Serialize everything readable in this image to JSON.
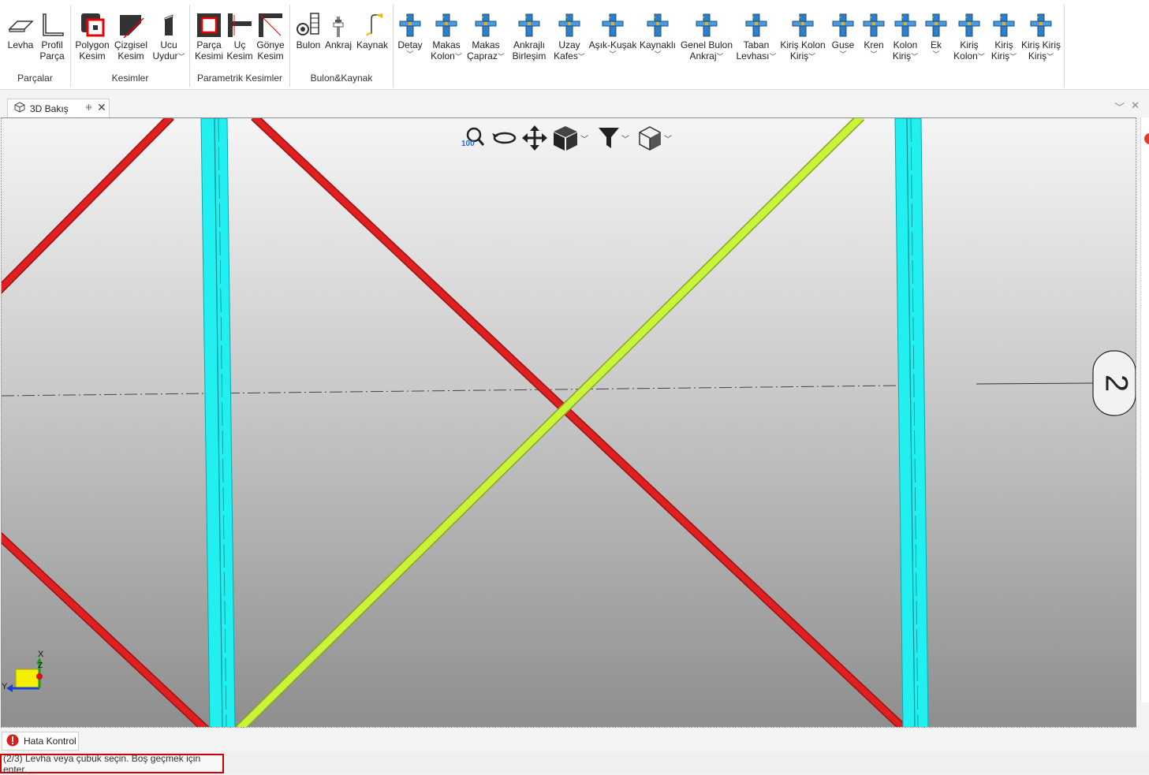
{
  "ribbon": {
    "groups": [
      {
        "title": "Parçalar"
      },
      {
        "title": "Kesimler"
      },
      {
        "title": "Parametrik Kesimler"
      },
      {
        "title": "Bulon&Kaynak"
      }
    ],
    "tools": {
      "levha": "Levha",
      "profil_parca": [
        "Profil",
        "Parça"
      ],
      "polygon_kesim": [
        "Polygon",
        "Kesim"
      ],
      "cizgisel_kesim": [
        "Çizgisel",
        "Kesim"
      ],
      "ucu_uydur": [
        "Ucu",
        "Uydur"
      ],
      "parca_kesimi": [
        "Parça",
        "Kesimi"
      ],
      "uc_kesim": [
        "Uç",
        "Kesim"
      ],
      "gonye_kesim": [
        "Gönye",
        "Kesim"
      ],
      "bulon": "Bulon",
      "ankraj": "Ankraj",
      "kaynak": "Kaynak",
      "detay": "Detay",
      "makas_kolon": [
        "Makas",
        "Kolon"
      ],
      "makas_capraz": [
        "Makas",
        "Çapraz"
      ],
      "ankrajli_birlesim": [
        "Ankrajlı",
        "Birleşim"
      ],
      "uzay_kafes": [
        "Uzay",
        "Kafes"
      ],
      "asik_kusak": "Aşık-Kuşak",
      "kaynakli": "Kaynaklı",
      "genel_bulon_ankraj": [
        "Genel Bulon",
        "Ankraj"
      ],
      "taban_levhasi": [
        "Taban",
        "Levhası"
      ],
      "kiris_kolon_kiris": [
        "Kiriş Kolon",
        "Kiriş"
      ],
      "guse": "Guse",
      "kren": "Kren",
      "kolon_kiris": [
        "Kolon",
        "Kiriş"
      ],
      "ek": "Ek",
      "kiris_kolon": [
        "Kiriş",
        "Kolon"
      ],
      "kiris_kiris": [
        "Kiriş",
        "Kiriş"
      ],
      "kiris_kiris_kiris": [
        "Kiriş Kiriş",
        "Kiriş"
      ]
    }
  },
  "tab": {
    "label": "3D Bakış"
  },
  "view_toolbar": {
    "zoom_value": "100"
  },
  "scene": {
    "grid_label": "2",
    "axis_labels": {
      "x": "X",
      "y": "Y",
      "z": "Z"
    },
    "colors": {
      "column": "#22f0f0",
      "brace_red": "#e02020",
      "brace_selected": "#c8f53a"
    }
  },
  "bottom_tab": {
    "label": "Hata Kontrol"
  },
  "status": {
    "prompt": "(2/3) Levha veya çubuk seçin. Boş geçmek için enter."
  }
}
